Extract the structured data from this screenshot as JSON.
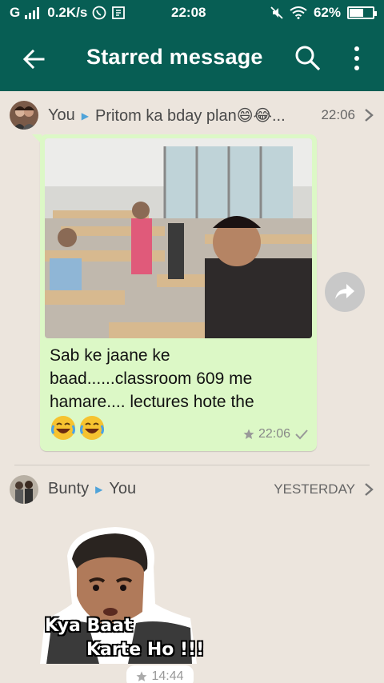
{
  "status_bar": {
    "carrier": "G",
    "speed": "0.2K/s",
    "time": "22:08",
    "battery": "62%",
    "battery_level": 0.62
  },
  "app_bar": {
    "title": "Starred message",
    "back_icon": "arrow-back-icon",
    "search_icon": "search-icon",
    "more_icon": "more-vert-icon"
  },
  "messages": [
    {
      "from": "You",
      "to": "Pritom ka bday plan😄😂...",
      "header_time": "22:06",
      "caption": "Sab ke jaane ke baad......classroom 609 me hamare.... lectures hote the",
      "emojis": "😂😂",
      "time": "22:06"
    },
    {
      "from": "Bunty",
      "to": "You",
      "header_time": "YESTERDAY",
      "sticker_line1": "Kya Baat",
      "sticker_line2": "Karte Ho !!!",
      "time": "14:44"
    }
  ],
  "colors": {
    "primary": "#075e54",
    "bubble": "#dcf8c6",
    "background": "#ece5dd",
    "accent": "#4fa3d9"
  }
}
